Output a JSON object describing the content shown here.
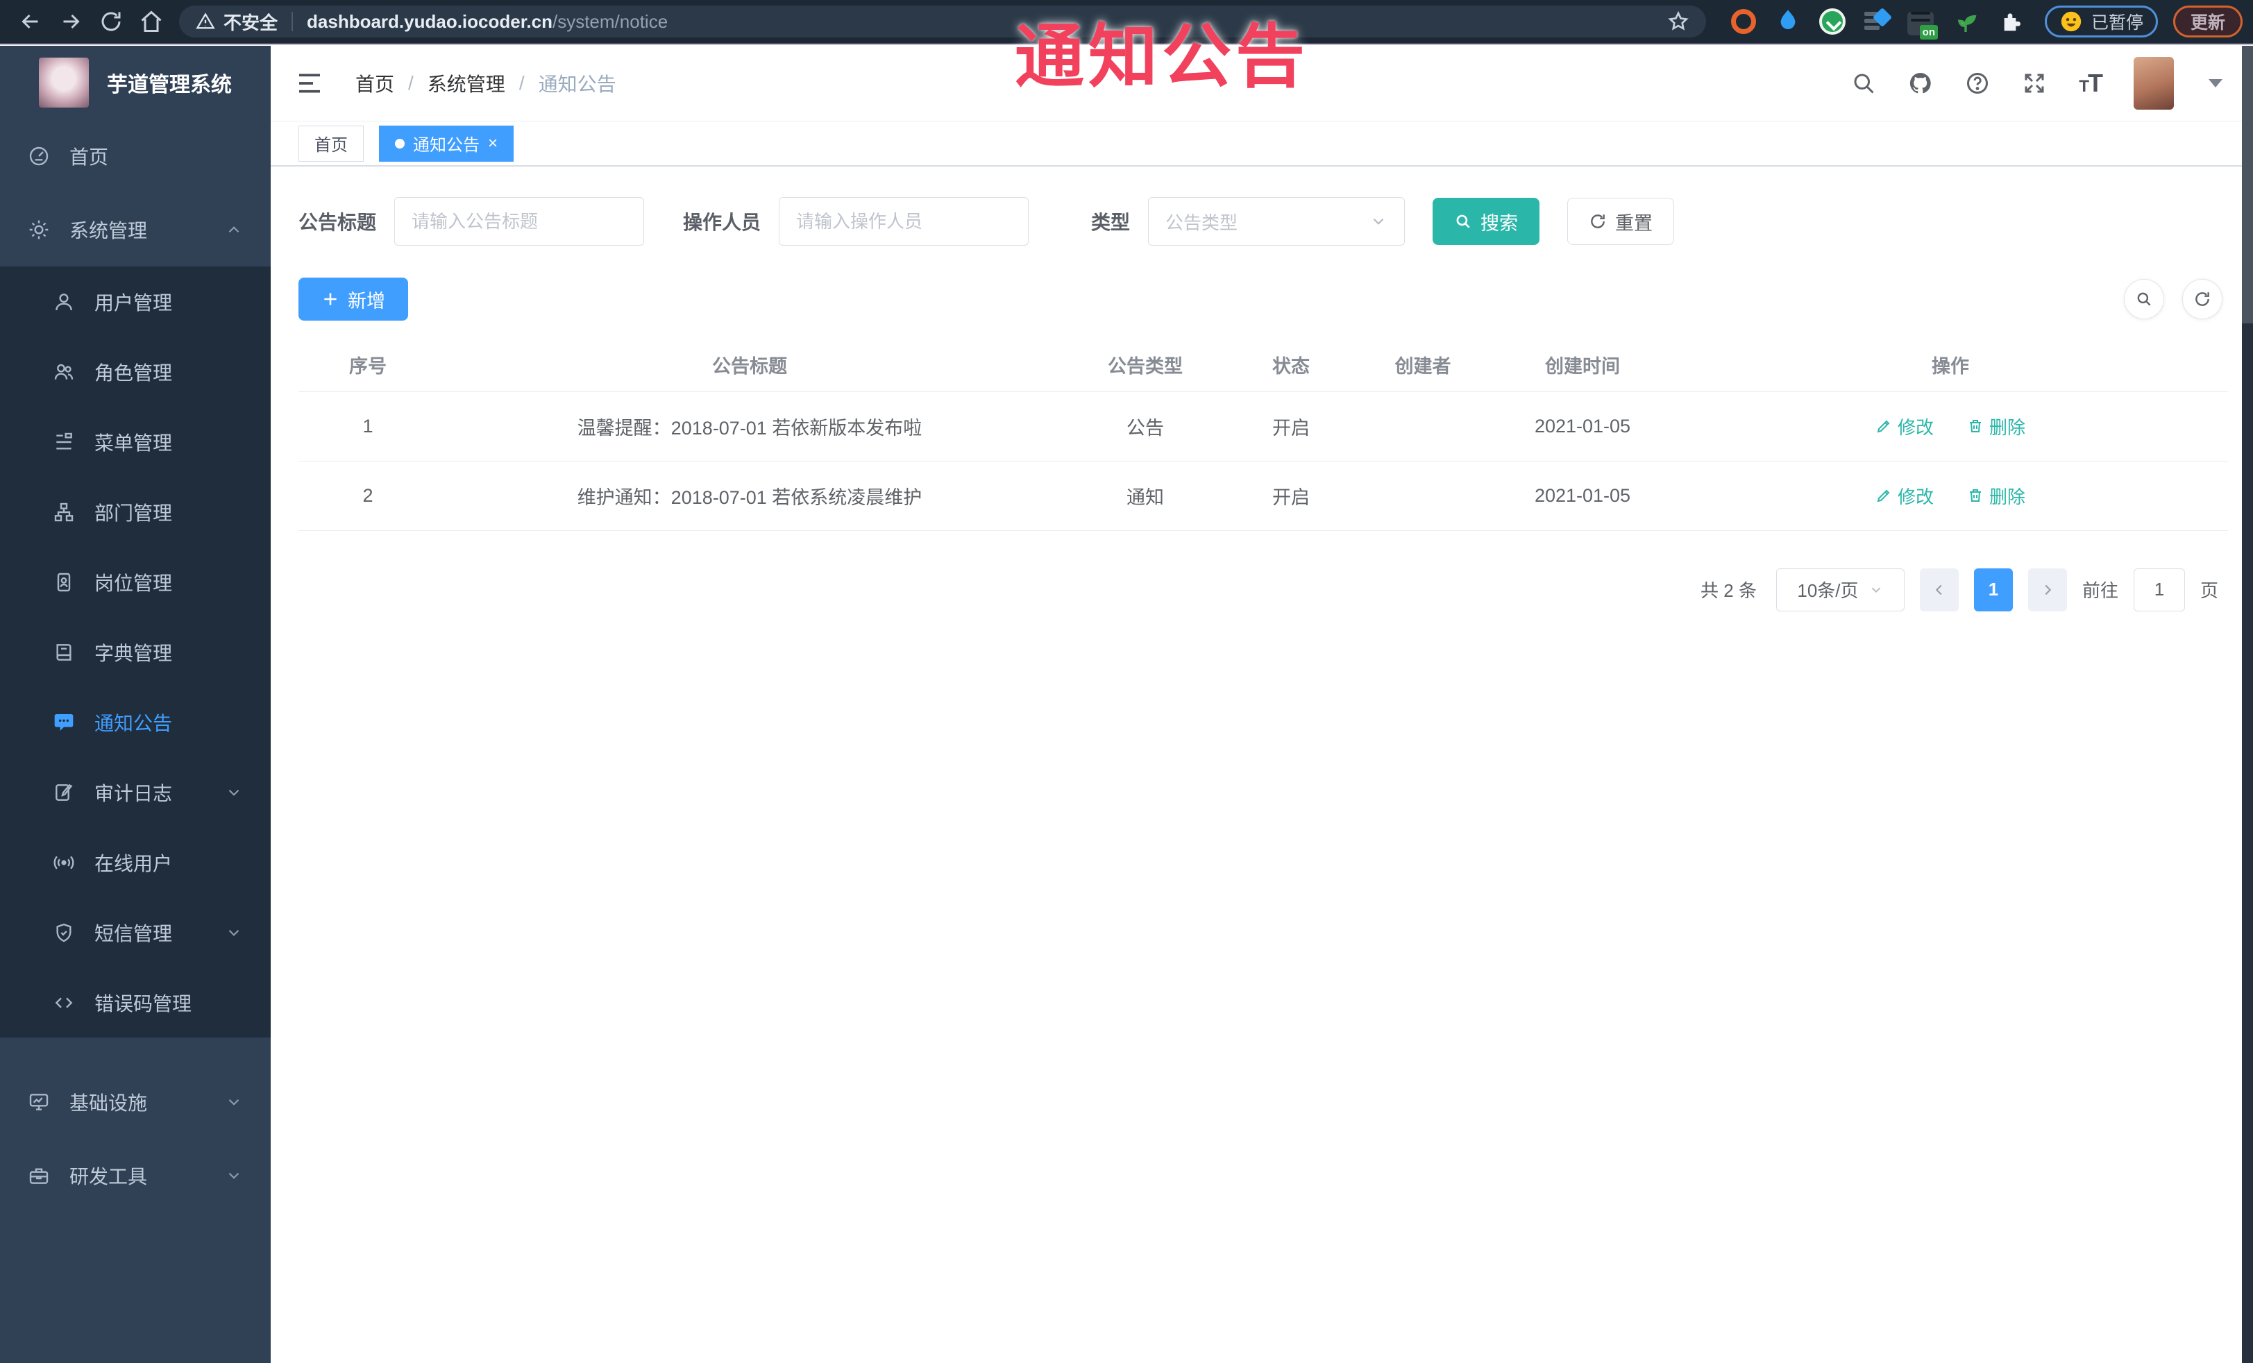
{
  "browser": {
    "security_warning": "不安全",
    "url_host": "dashboard.yudao.iocoder.cn",
    "url_path": "/system/notice",
    "extension_on_badge": "on",
    "paused_label": "已暂停",
    "update_label": "更新"
  },
  "watermark": {
    "text": "通知公告"
  },
  "sidebar": {
    "app_title": "芋道管理系统",
    "items": [
      {
        "label": "首页"
      },
      {
        "label": "系统管理",
        "arrow": "up"
      },
      {
        "label": "用户管理"
      },
      {
        "label": "角色管理"
      },
      {
        "label": "菜单管理"
      },
      {
        "label": "部门管理"
      },
      {
        "label": "岗位管理"
      },
      {
        "label": "字典管理"
      },
      {
        "label": "通知公告",
        "active": true
      },
      {
        "label": "审计日志",
        "arrow": "down"
      },
      {
        "label": "在线用户"
      },
      {
        "label": "短信管理",
        "arrow": "down"
      },
      {
        "label": "错误码管理"
      },
      {
        "label": "基础设施",
        "arrow": "down"
      },
      {
        "label": "研发工具",
        "arrow": "down"
      }
    ]
  },
  "header": {
    "breadcrumb": [
      "首页",
      "系统管理",
      "通知公告"
    ]
  },
  "tags": [
    {
      "label": "首页",
      "active": false
    },
    {
      "label": "通知公告",
      "active": true
    }
  ],
  "filters": {
    "title_label": "公告标题",
    "title_placeholder": "请输入公告标题",
    "operator_label": "操作人员",
    "operator_placeholder": "请输入操作人员",
    "type_label": "类型",
    "type_placeholder": "公告类型",
    "search_label": "搜索",
    "reset_label": "重置"
  },
  "toolbar": {
    "add_label": "新增"
  },
  "table": {
    "columns": [
      "序号",
      "公告标题",
      "公告类型",
      "状态",
      "创建者",
      "创建时间",
      "操作"
    ],
    "rows": [
      {
        "index": "1",
        "title": "温馨提醒：2018-07-01 若依新版本发布啦",
        "type": "公告",
        "status": "开启",
        "creator": "",
        "create_time": "2021-01-05"
      },
      {
        "index": "2",
        "title": "维护通知：2018-07-01 若依系统凌晨维护",
        "type": "通知",
        "status": "开启",
        "creator": "",
        "create_time": "2021-01-05"
      }
    ],
    "actions": {
      "edit": "修改",
      "delete": "删除"
    }
  },
  "pagination": {
    "total": "共 2 条",
    "page_size": "10条/页",
    "current": "1",
    "goto_label": "前往",
    "goto_value": "1",
    "page_label": "页"
  },
  "colors": {
    "accent_blue": "#409eff",
    "teal_action": "#2ab7a9",
    "watermark_red": "#f2415c",
    "sidebar_bg": "#304156",
    "submenu_bg": "#1f2d3d",
    "chrome_bg": "#1d2835"
  }
}
